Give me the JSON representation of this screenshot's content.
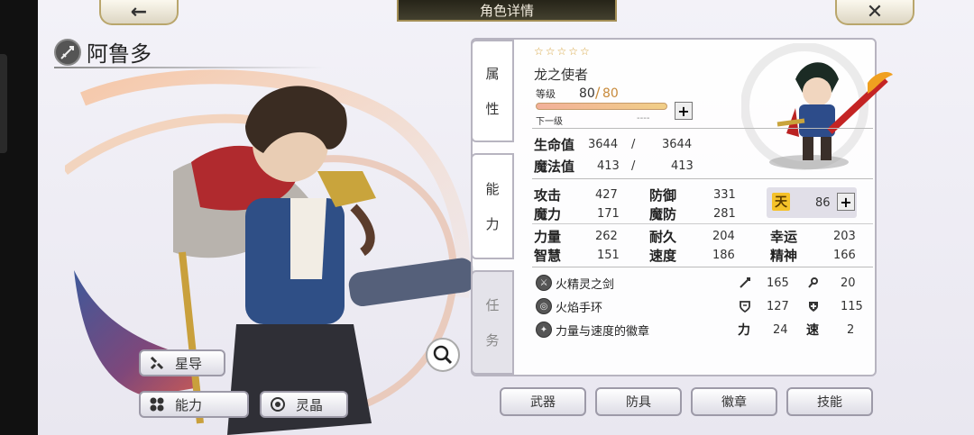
{
  "header": {
    "title": "角色详情",
    "back_icon": "←",
    "close_icon": "✕"
  },
  "character": {
    "name": "阿鲁多",
    "rarity_stars": "☆☆☆☆☆",
    "title": "龙之使者"
  },
  "level": {
    "label": "等级",
    "current": "80",
    "max": "80",
    "next_label": "下一级",
    "next_value": "----",
    "progress": 1.0
  },
  "vitals": [
    {
      "label": "生命值",
      "current": "3644",
      "max": "3644"
    },
    {
      "label": "魔法值",
      "current": "413",
      "max": "413"
    }
  ],
  "side_tabs": [
    {
      "c1": "属",
      "c2": "性"
    },
    {
      "c1": "能",
      "c2": "力"
    },
    {
      "c1": "任",
      "c2": "务"
    }
  ],
  "stats": {
    "atk": {
      "label": "攻击",
      "value": "427"
    },
    "def": {
      "label": "防御",
      "value": "331"
    },
    "mag": {
      "label": "魔力",
      "value": "171"
    },
    "mdef": {
      "label": "魔防",
      "value": "281"
    },
    "str": {
      "label": "力量",
      "value": "262"
    },
    "end": {
      "label": "耐久",
      "value": "204"
    },
    "luck": {
      "label": "幸运",
      "value": "203"
    },
    "int": {
      "label": "智慧",
      "value": "151"
    },
    "spd": {
      "label": "速度",
      "value": "186"
    },
    "spi": {
      "label": "精神",
      "value": "166"
    },
    "ten": {
      "icon_char": "天",
      "value": "86"
    }
  },
  "equipment": [
    {
      "name": "火精灵之剑",
      "stat1": "165",
      "stat2": "20"
    },
    {
      "name": "火焰手环",
      "stat1": "127",
      "stat2": "115"
    },
    {
      "name": "力量与速度的徽章",
      "stat1_label": "力",
      "stat1": "24",
      "stat2_label": "速",
      "stat2": "2"
    }
  ],
  "left_buttons": {
    "star_guide": "星导",
    "ability": "能力",
    "crystal": "灵晶"
  },
  "bottom_tabs": {
    "weapon": "武器",
    "armor": "防具",
    "badge": "徽章",
    "skill": "技能"
  },
  "colors": {
    "accent_gold": "#b9a66c",
    "level_orange": "#c88a3a",
    "star_gold": "#d6a33d"
  }
}
